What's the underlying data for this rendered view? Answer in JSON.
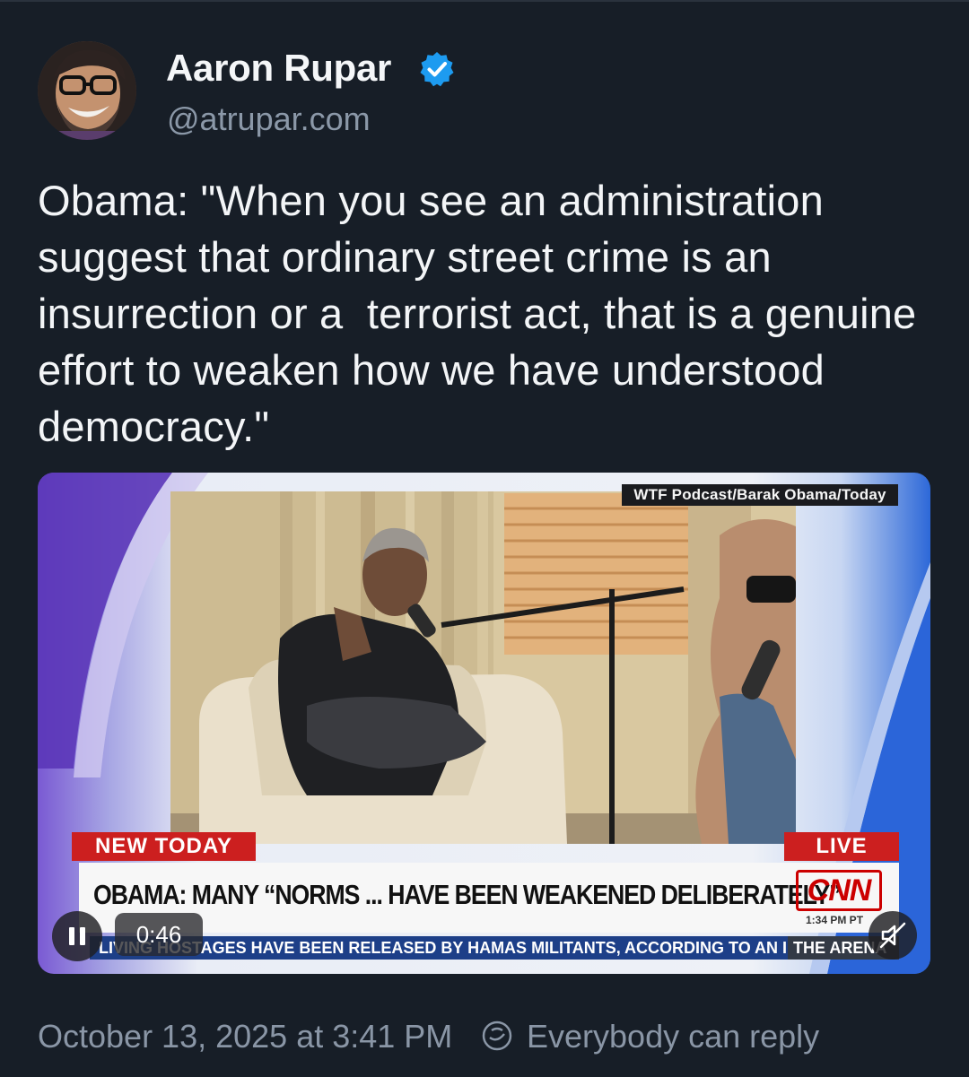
{
  "post": {
    "author_name": "Aaron Rupar",
    "handle": "@atrupar.com",
    "avatar_icon": "user-avatar",
    "verified_icon": "verified-check-icon",
    "text": "Obama: \"When you see an administration suggest that ordinary street crime is an insurrection or a  terrorist act, that is a genuine effort to weaken how we have understood democracy.\"",
    "timestamp": "October 13, 2025 at 3:41 PM",
    "reply_setting": "Everybody can reply"
  },
  "video": {
    "source_tag": "WTF Podcast/Barak Obama/Today",
    "badge_new": "NEW TODAY",
    "badge_live": "LIVE",
    "headline": "OBAMA: MANY “NORMS ... HAVE BEEN WEAKENED DELIBERATELY”",
    "network_logo": "CNN",
    "clock": "1:34 PM PT",
    "ticker": "LIVING HOSTAGES HAVE BEEN RELEASED BY HAMAS MILITANTS, ACCORDING TO AN I",
    "ticker_right": "THE ARENA",
    "elapsed": "0:46",
    "playing": true,
    "muted": true
  },
  "colors": {
    "background": "#171e27",
    "verified_blue": "#1d9bf0",
    "muted_text": "#8a96a6",
    "cnn_red": "#cc1f1f"
  }
}
